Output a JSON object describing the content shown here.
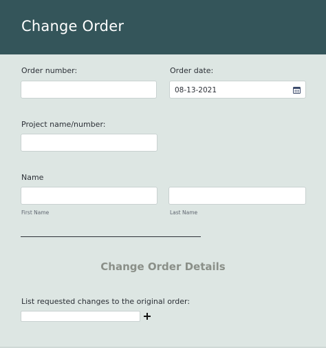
{
  "header": {
    "title": "Change Order"
  },
  "form": {
    "order_number": {
      "label": "Order number:",
      "value": ""
    },
    "order_date": {
      "label": "Order date:",
      "value": "08-13-2021"
    },
    "project": {
      "label": "Project name/number:",
      "value": ""
    },
    "name": {
      "label": "Name",
      "first_sublabel": "First Name",
      "last_sublabel": "Last Name",
      "first_value": "",
      "last_value": ""
    },
    "details_title": "Change Order Details",
    "changes": {
      "label": "List requested changes to the original order:",
      "value": ""
    }
  },
  "icons": {
    "calendar": "calendar-icon",
    "add": "plus-icon"
  }
}
